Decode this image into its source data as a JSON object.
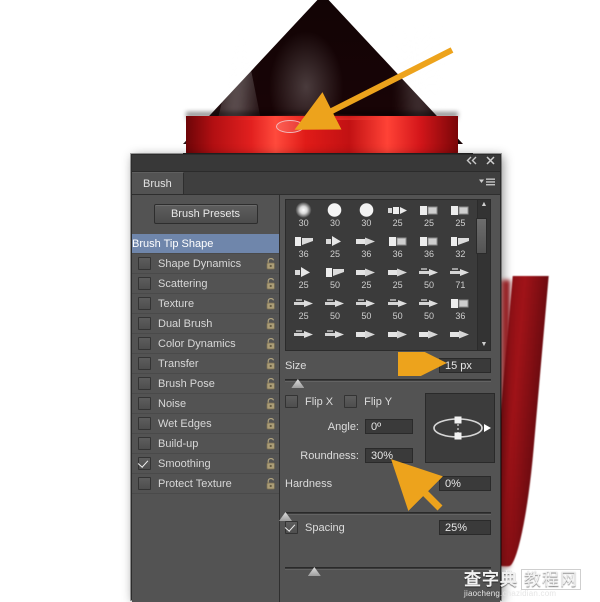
{
  "window": {
    "title_bar": {
      "collapse_icon": "double-left-chevron-icon",
      "close_icon": "close-icon"
    },
    "tab": "Brush",
    "panel_menu_icon": "panel-menu-icon"
  },
  "left": {
    "presets_button": "Brush Presets",
    "options": [
      {
        "label": "Brush Tip Shape",
        "checkbox": null,
        "selected": true,
        "lock": false
      },
      {
        "label": "Shape Dynamics",
        "checkbox": false,
        "selected": false,
        "lock": true
      },
      {
        "label": "Scattering",
        "checkbox": false,
        "selected": false,
        "lock": true
      },
      {
        "label": "Texture",
        "checkbox": false,
        "selected": false,
        "lock": true
      },
      {
        "label": "Dual Brush",
        "checkbox": false,
        "selected": false,
        "lock": true
      },
      {
        "label": "Color Dynamics",
        "checkbox": false,
        "selected": false,
        "lock": true
      },
      {
        "label": "Transfer",
        "checkbox": false,
        "selected": false,
        "lock": true
      },
      {
        "label": "Brush Pose",
        "checkbox": false,
        "selected": false,
        "lock": true
      },
      {
        "label": "Noise",
        "checkbox": false,
        "selected": false,
        "lock": true
      },
      {
        "label": "Wet Edges",
        "checkbox": false,
        "selected": false,
        "lock": true
      },
      {
        "label": "Build-up",
        "checkbox": false,
        "selected": false,
        "lock": true
      },
      {
        "label": "Smoothing",
        "checkbox": true,
        "selected": false,
        "lock": true
      },
      {
        "label": "Protect Texture",
        "checkbox": false,
        "selected": false,
        "lock": true
      }
    ]
  },
  "brush_grid": {
    "scrollbar": {
      "up_arrow": "scroll-up-arrow-icon",
      "down_arrow": "scroll-down-arrow-icon"
    },
    "tips": [
      {
        "size": "30",
        "shape": "soft-round"
      },
      {
        "size": "30",
        "shape": "hard-round"
      },
      {
        "size": "30",
        "shape": "hard-round"
      },
      {
        "size": "25",
        "shape": "flat-tip"
      },
      {
        "size": "25",
        "shape": "square-tip"
      },
      {
        "size": "25",
        "shape": "square-tip"
      },
      {
        "size": "36",
        "shape": "angled-tip"
      },
      {
        "size": "25",
        "shape": "fan-tip"
      },
      {
        "size": "36",
        "shape": "round-point"
      },
      {
        "size": "36",
        "shape": "square-tip"
      },
      {
        "size": "36",
        "shape": "square-tip"
      },
      {
        "size": "32",
        "shape": "angled-tip"
      },
      {
        "size": "25",
        "shape": "fan-tip"
      },
      {
        "size": "50",
        "shape": "angled-tip"
      },
      {
        "size": "25",
        "shape": "round-point"
      },
      {
        "size": "25",
        "shape": "round-point"
      },
      {
        "size": "50",
        "shape": "textured-point"
      },
      {
        "size": "71",
        "shape": "textured-point"
      },
      {
        "size": "25",
        "shape": "textured-point"
      },
      {
        "size": "50",
        "shape": "textured-point"
      },
      {
        "size": "50",
        "shape": "textured-point"
      },
      {
        "size": "50",
        "shape": "textured-point"
      },
      {
        "size": "50",
        "shape": "textured-point"
      },
      {
        "size": "36",
        "shape": "square-tip"
      },
      {
        "size": "",
        "shape": "textured-point"
      },
      {
        "size": "",
        "shape": "textured-point"
      },
      {
        "size": "",
        "shape": "round-point"
      },
      {
        "size": "",
        "shape": "round-point"
      },
      {
        "size": "",
        "shape": "round-point"
      },
      {
        "size": "",
        "shape": "round-point"
      }
    ]
  },
  "controls": {
    "size": {
      "label": "Size",
      "value": "15 px",
      "slider_pct": 6
    },
    "flip_x": {
      "label": "Flip X",
      "checked": false
    },
    "flip_y": {
      "label": "Flip Y",
      "checked": false
    },
    "angle": {
      "label": "Angle:",
      "value": "0º"
    },
    "roundness": {
      "label": "Roundness:",
      "value": "30%"
    },
    "hardness": {
      "label": "Hardness",
      "value": "0%",
      "slider_pct": 0
    },
    "spacing": {
      "label": "Spacing",
      "value": "25%",
      "checked": true,
      "slider_pct": 14
    },
    "preview_icon": "brush-angle-roundness-preview"
  },
  "annotations": {
    "arrow_color": "#eda31c",
    "arrows": [
      {
        "name": "arrow-to-brush-stroke",
        "points_to": "ellipse brush stroke on cone"
      },
      {
        "name": "arrow-to-size-field",
        "points_to": "Size value field"
      },
      {
        "name": "arrow-to-roundness-field",
        "points_to": "Roundness value field"
      }
    ]
  },
  "watermark": {
    "cn_left": "查字典",
    "cn_right": "教程网",
    "url": "jiaocheng.chazidian.com"
  }
}
